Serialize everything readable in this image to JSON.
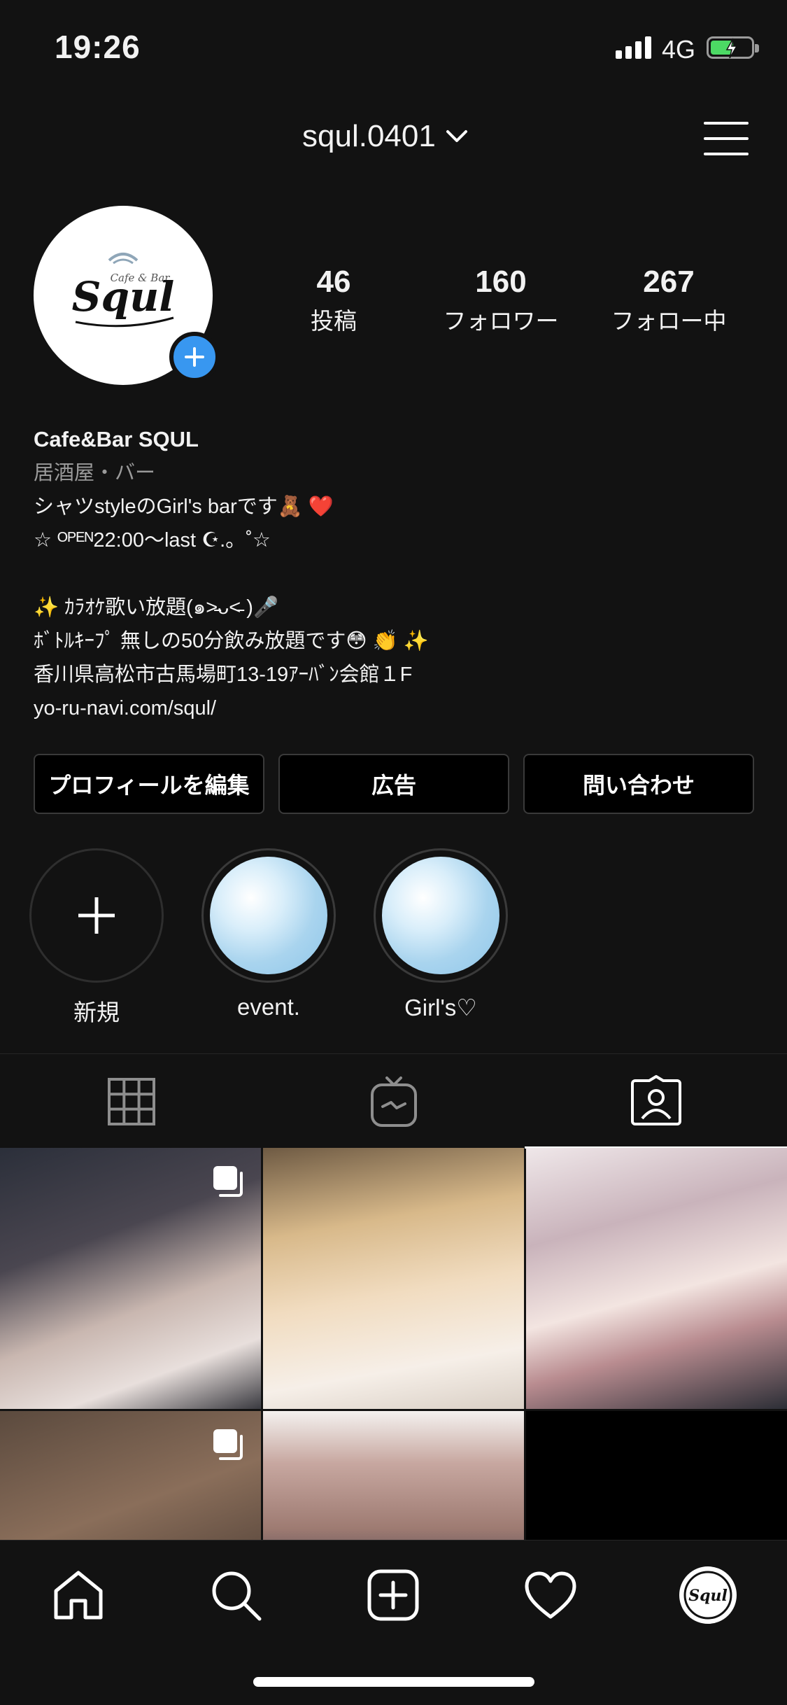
{
  "status_bar": {
    "time": "19:26",
    "network": "4G"
  },
  "header": {
    "username": "squl.0401"
  },
  "profile": {
    "avatar_text": "Squl",
    "avatar_subtext": "Cafe & Bar",
    "stats": [
      {
        "value": "46",
        "label": "投稿"
      },
      {
        "value": "160",
        "label": "フォロワー"
      },
      {
        "value": "267",
        "label": "フォロー中"
      }
    ],
    "name": "Cafe&Bar SQUL",
    "category": "居酒屋・バー",
    "bio_lines": [
      "シャツstyleのGirl's barです🧸 ❤️",
      "☆ ᴼᴾᴱᴺ22:00〜last ☪︎.。˚☆",
      "",
      "✨ ｶﾗｵｹ歌い放題(๑˃̵ᴗ˂̵ )🎤",
      "ﾎﾞﾄﾙｷｰﾌﾟ 無しの50分飲み放題です😳 👏 ✨",
      "香川県高松市古馬場町13-19ｱｰﾊﾞﾝ会館１F",
      "yo-ru-navi.com/squl/"
    ]
  },
  "actions": {
    "edit_profile": "プロフィールを編集",
    "ads": "広告",
    "contact": "問い合わせ"
  },
  "highlights": [
    {
      "label": "新規"
    },
    {
      "label": "event."
    },
    {
      "label": "Girl's♡"
    }
  ],
  "icons": {
    "tabs": [
      "grid-icon",
      "igtv-icon",
      "tagged-icon"
    ],
    "nav": [
      "home-icon",
      "search-icon",
      "new-post-icon",
      "heart-icon",
      "profile-icon"
    ]
  },
  "colors": {
    "background": "#121212",
    "accent_blue": "#3897f0",
    "battery_green": "#4cd964"
  }
}
